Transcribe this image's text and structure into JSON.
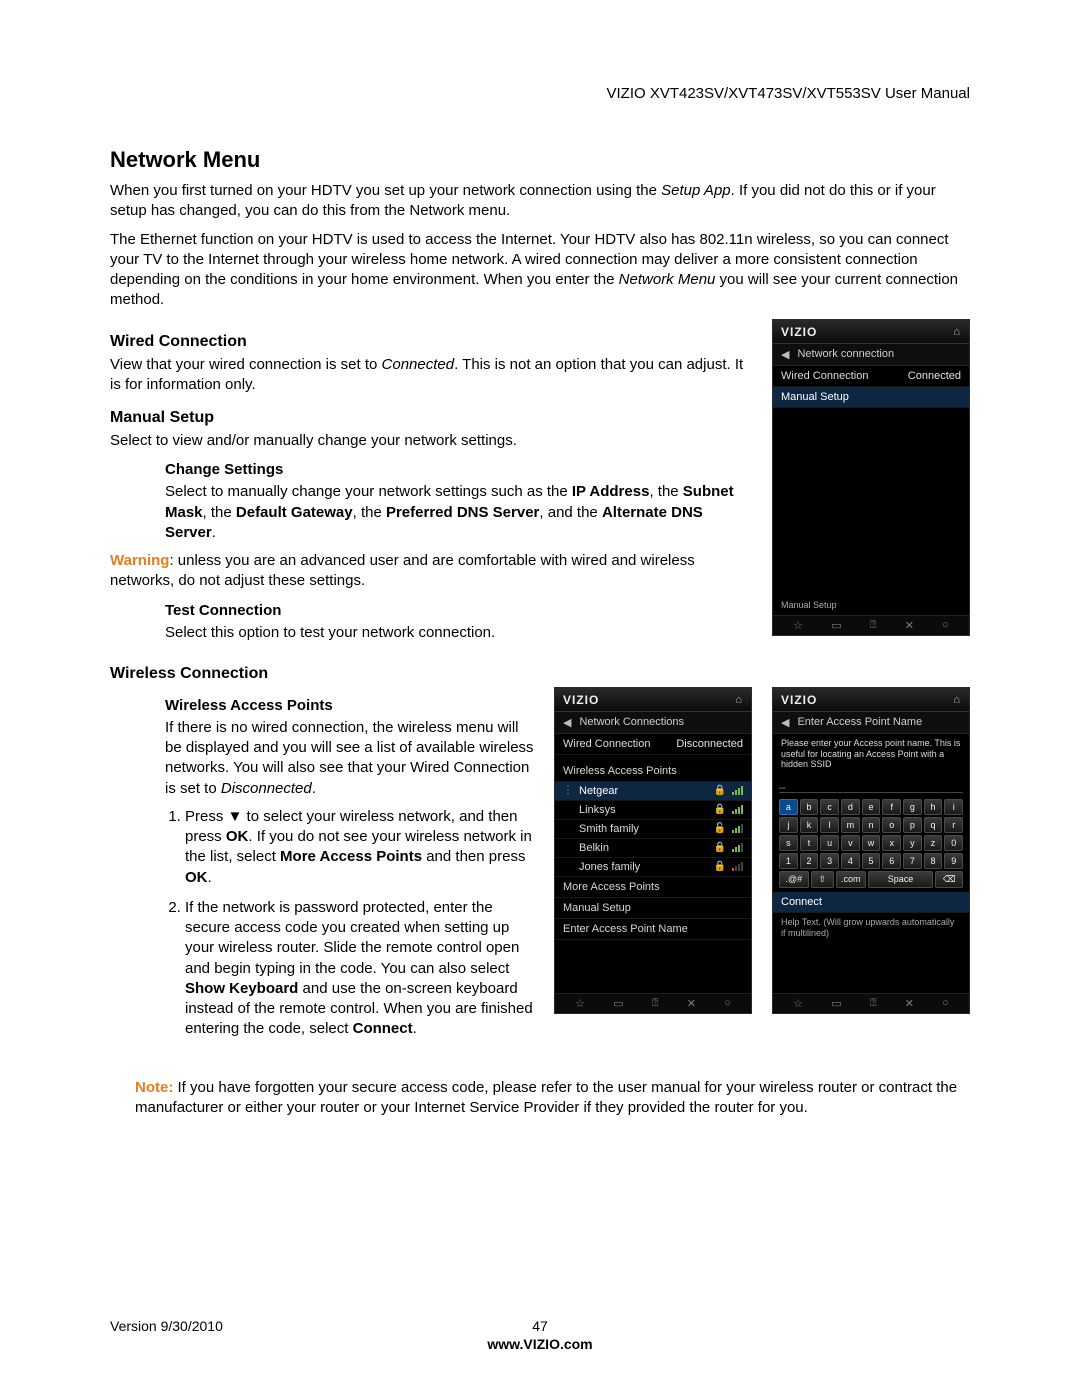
{
  "header": {
    "product": "VIZIO XVT423SV/XVT473SV/XVT553SV User Manual"
  },
  "h1": "Network Menu",
  "intro1_a": "When you first turned on your HDTV you set up your network connection using the ",
  "intro1_b": "Setup App",
  "intro1_c": ". If you did not do this or if your setup has changed, you can do this from the Network menu.",
  "intro2_a": "The Ethernet function on your HDTV is used to access the Internet. Your HDTV also has 802.11n wireless, so you can connect your TV to the Internet through your wireless home network. A wired connection may deliver a more consistent connection depending on the conditions in your home environment. When you enter the ",
  "intro2_b": "Network Menu",
  "intro2_c": " you will see your current connection method.",
  "wired_h": "Wired Connection",
  "wired_p_a": "View that your wired connection is set to ",
  "wired_p_b": "Connected",
  "wired_p_c": ". This is not an option that you can adjust. It is for information only.",
  "manual_h": "Manual Setup",
  "manual_p": "Select to view and/or manually change your network settings.",
  "change_h": "Change Settings",
  "change_p_a": "Select to manually change your network settings such as the ",
  "change_p_b": "IP Address",
  "change_p_c": ", the ",
  "change_p_d": "Subnet Mask",
  "change_p_e": ", the ",
  "change_p_f": "Default Gateway",
  "change_p_g": ", the ",
  "change_p_h": "Preferred DNS Server",
  "change_p_i": ", and the ",
  "change_p_j": "Alternate DNS Server",
  "change_p_k": ".",
  "warn_label": "Warning",
  "warn_text": ": unless you are an advanced user and are comfortable with wired and wireless networks, do not adjust these settings.",
  "test_h": "Test Connection",
  "test_p": "Select this option to test your network connection.",
  "wireless_h": "Wireless Connection",
  "wap_h": "Wireless Access Points",
  "wap_p_a": "If there is no wired connection, the wireless menu will be displayed and you will see a list of available wireless networks. You will also see that your Wired Connection is set to ",
  "wap_p_b": "Disconnected",
  "wap_p_c": ".",
  "step1_a": "Press ▼ to select your wireless network, and then press ",
  "step1_b": "OK",
  "step1_c": ". If you do not see your wireless network in the list, select ",
  "step1_d": "More Access Points",
  "step1_e": " and then press ",
  "step1_f": "OK",
  "step1_g": ".",
  "step2_a": "If the network is password protected, enter the secure access code you created when setting up your wireless router. Slide the remote control open and begin typing in the code. You can also select ",
  "step2_b": "Show Keyboard",
  "step2_c": " and use the on-screen keyboard instead of the remote control. When you are finished entering the code, select ",
  "step2_d": "Connect",
  "step2_e": ".",
  "note_label": "Note:",
  "note_text": " If you have forgotten your secure access code, please refer to the user manual for your wireless router or contract the manufacturer or either your router or your Internet Service Provider if they provided the router for you.",
  "footer": {
    "version": "Version 9/30/2010",
    "page": "47",
    "site": "www.VIZIO.com"
  },
  "panel1": {
    "brand": "VIZIO",
    "title": "Network connection",
    "rows": [
      {
        "label": "Wired Connection",
        "value": "Connected"
      },
      {
        "label": "Manual Setup",
        "value": "",
        "sel": true
      }
    ],
    "hint": "Manual Setup"
  },
  "panel2": {
    "brand": "VIZIO",
    "title": "Network Connections",
    "status_label": "Wired Connection",
    "status_value": "Disconnected",
    "section": "Wireless Access Points",
    "networks": [
      {
        "name": "Netgear",
        "locked": true,
        "sig": 4,
        "sel": true,
        "active": true
      },
      {
        "name": "Linksys",
        "locked": true,
        "sig": 4
      },
      {
        "name": "Smith family",
        "locked": true,
        "sig": 3
      },
      {
        "name": "Belkin",
        "locked": true,
        "sig": 3
      },
      {
        "name": "Jones family",
        "locked": true,
        "sig": 1,
        "weak": true
      }
    ],
    "more": "More Access Points",
    "manual": "Manual Setup",
    "enter": "Enter Access Point Name"
  },
  "panel3": {
    "brand": "VIZIO",
    "title": "Enter Access Point Name",
    "prompt": "Please enter your Access point name. This is useful for locating an Access Point with a hidden SSID",
    "kb_rows": [
      [
        "a",
        "b",
        "c",
        "d",
        "e",
        "f",
        "g",
        "h",
        "i"
      ],
      [
        "j",
        "k",
        "l",
        "m",
        "n",
        "o",
        "p",
        "q",
        "r"
      ],
      [
        "s",
        "t",
        "u",
        "v",
        "w",
        "x",
        "y",
        "z",
        "0"
      ],
      [
        "1",
        "2",
        "3",
        "4",
        "5",
        "6",
        "7",
        "8",
        "9"
      ]
    ],
    "kb_bottom": [
      ".@#",
      "⇧",
      ".com",
      "Space",
      "⌫"
    ],
    "connect": "Connect",
    "hint": "Help Text. (Will grow upwards automatically if multilined)"
  },
  "foot_icons": [
    "☆",
    "▭",
    "⍰",
    "✕",
    "○"
  ]
}
